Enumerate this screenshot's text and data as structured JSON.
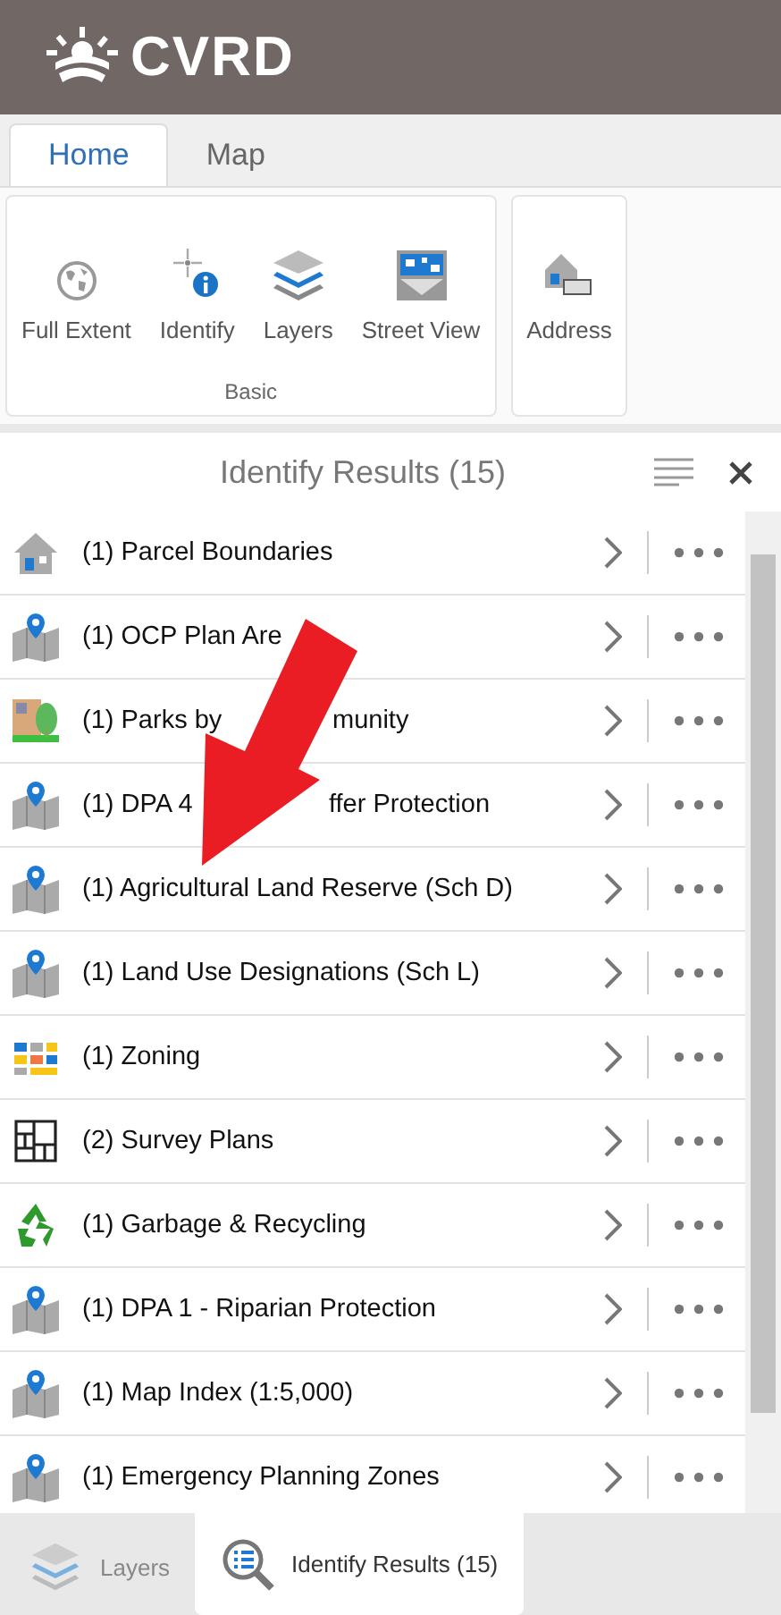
{
  "header": {
    "logo_text": "CVRD"
  },
  "tabs": [
    {
      "label": "Home",
      "selected": true
    },
    {
      "label": "Map",
      "selected": false
    }
  ],
  "ribbon": {
    "groups": [
      {
        "label": "Basic",
        "tools": [
          {
            "kind": "globe",
            "label": "Full Extent"
          },
          {
            "kind": "identify",
            "label": "Identify"
          },
          {
            "kind": "layers",
            "label": "Layers"
          },
          {
            "kind": "street",
            "label": "Street View"
          }
        ]
      },
      {
        "tools": [
          {
            "kind": "address",
            "label": "Address"
          }
        ]
      }
    ]
  },
  "panel": {
    "title": "Identify Results (15)",
    "results": [
      {
        "kind": "parcel",
        "label": "(1) Parcel Boundaries"
      },
      {
        "kind": "pin",
        "label": "(1) OCP Plan Are"
      },
      {
        "kind": "park",
        "label": "(1) Parks by",
        "label_after": "munity"
      },
      {
        "kind": "pin",
        "label": "(1) DPA 4",
        "label_after": "ffer Protection"
      },
      {
        "kind": "pin",
        "label": "(1) Agricultural Land Reserve (Sch D)"
      },
      {
        "kind": "pin",
        "label": "(1) Land Use Designations (Sch L)"
      },
      {
        "kind": "zoning",
        "label": "(1) Zoning"
      },
      {
        "kind": "survey",
        "label": "(2) Survey Plans"
      },
      {
        "kind": "recycle",
        "label": "(1) Garbage & Recycling"
      },
      {
        "kind": "pin",
        "label": "(1) DPA 1 - Riparian Protection"
      },
      {
        "kind": "pin",
        "label": "(1) Map Index (1:5,000)"
      },
      {
        "kind": "pin",
        "label": "(1) Emergency Planning Zones"
      }
    ]
  },
  "bottom_tabs": [
    {
      "kind": "layers",
      "label": "Layers",
      "selected": false
    },
    {
      "kind": "results",
      "label": "Identify Results (15)",
      "selected": true
    }
  ]
}
